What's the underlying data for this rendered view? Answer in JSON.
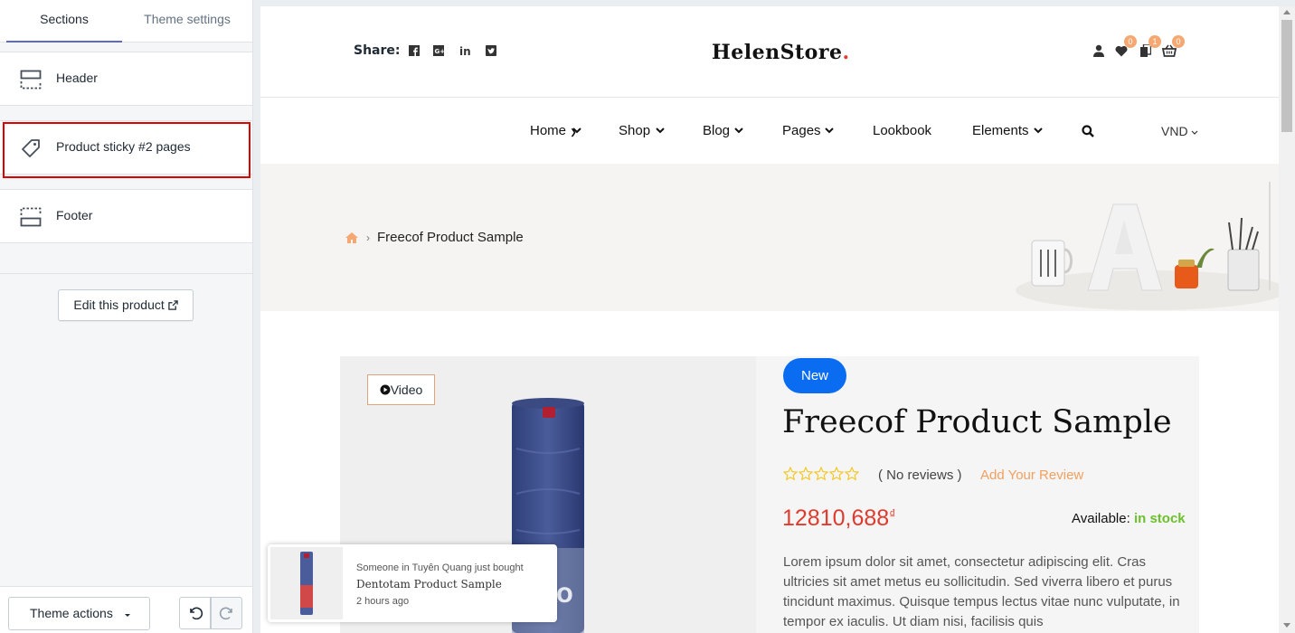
{
  "sidebar": {
    "tabs": [
      "Sections",
      "Theme settings"
    ],
    "sections": [
      {
        "label": "Header",
        "icon": "header-layout-icon"
      },
      {
        "label": "Product sticky #2 pages",
        "icon": "tag-icon"
      },
      {
        "label": "Footer",
        "icon": "footer-layout-icon"
      }
    ],
    "edit_product": "Edit this product",
    "theme_actions": "Theme actions"
  },
  "store": {
    "share_label": "Share:",
    "logo": "HelenStore",
    "badges": {
      "wishlist": "0",
      "compare": "1",
      "cart": "0"
    },
    "nav": [
      "Home",
      "Shop",
      "Blog",
      "Pages",
      "Lookbook",
      "Elements"
    ],
    "currency": "VND",
    "breadcrumb": "Freecof Product Sample",
    "video_label": "Video",
    "new_badge": "New",
    "product_title": "Freecof Product Sample",
    "reviews": "( No reviews )",
    "add_review": "Add Your Review",
    "price": "12810,688",
    "currency_symbol": "₫",
    "available_label": "Available:",
    "stock_status": "in stock",
    "description": "Lorem ipsum dolor sit amet, consectetur adipiscing elit. Cras ultricies sit amet metus eu sollicitudin. Sed viverra libero et purus tincidunt maximus. Quisque tempus lectus vitae nunc vulputate, in tempor ex iaculis. Ut diam nisi, facilisis quis",
    "toast": {
      "line1": "Someone in Tuyên Quang just bought",
      "product": "Dentotam Product Sample",
      "time": "2 hours ago"
    }
  },
  "colors": {
    "accent": "#5c6ac4",
    "price": "#e03a2e",
    "stock": "#6ac02d",
    "review": "#f0a060",
    "new_badge": "#0a6cf0"
  }
}
